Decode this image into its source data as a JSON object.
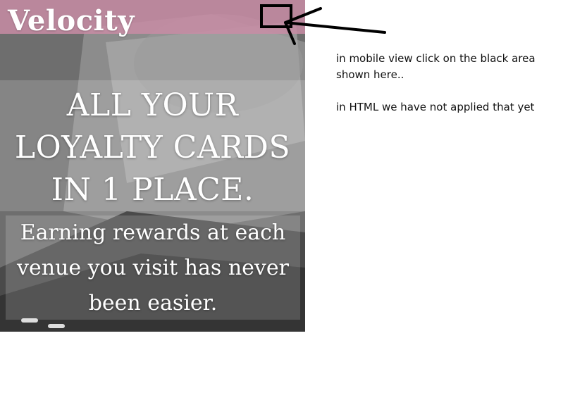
{
  "header": {
    "logo_text": "Velocity",
    "bar_color": "#c88ca5"
  },
  "hero": {
    "headline_line1": "ALL YOUR",
    "headline_line2": "LOYALTY CARDS",
    "headline_line3": "IN 1 PLACE.",
    "subtext_line1": "Earning rewards at each",
    "subtext_line2": "venue you visit has never",
    "subtext_line3": "been easier."
  },
  "annotation": {
    "note_line1": "in mobile view click on the black area shown here..",
    "note_line2": "in HTML we have not applied that yet"
  }
}
